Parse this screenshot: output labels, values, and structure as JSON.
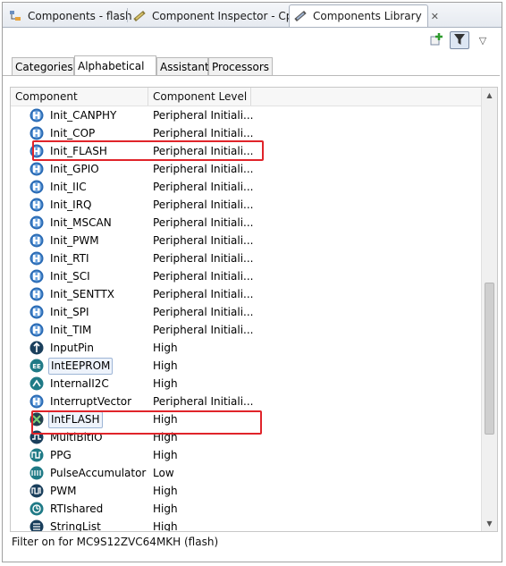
{
  "view_tabs": [
    {
      "label": "Components - flash",
      "icon": "components-tree-icon",
      "active": false
    },
    {
      "label": "Component Inspector - Cpu",
      "icon": "inspector-icon",
      "active": false
    },
    {
      "label": "Components Library",
      "icon": "library-icon",
      "active": true,
      "close": "✕"
    }
  ],
  "toolbar": {
    "add_tooltip": "add-component-icon",
    "filter_tooltip": "filter-icon",
    "menu_glyph": "▽"
  },
  "sub_tabs": [
    {
      "label": "Categories",
      "active": false
    },
    {
      "label": "Alphabetical",
      "active": true
    },
    {
      "label": "Assistant",
      "active": false
    },
    {
      "label": "Processors",
      "active": false
    }
  ],
  "table": {
    "columns": [
      "Component",
      "Component Level"
    ],
    "rows": [
      {
        "name": "Init_CANPHY",
        "level": "Peripheral Initiali...",
        "icon": "init-icon"
      },
      {
        "name": "Init_COP",
        "level": "Peripheral Initiali...",
        "icon": "init-icon"
      },
      {
        "name": "Init_FLASH",
        "level": "Peripheral Initiali...",
        "icon": "init-icon"
      },
      {
        "name": "Init_GPIO",
        "level": "Peripheral Initiali...",
        "icon": "init-icon"
      },
      {
        "name": "Init_IIC",
        "level": "Peripheral Initiali...",
        "icon": "init-icon"
      },
      {
        "name": "Init_IRQ",
        "level": "Peripheral Initiali...",
        "icon": "init-icon"
      },
      {
        "name": "Init_MSCAN",
        "level": "Peripheral Initiali...",
        "icon": "init-icon"
      },
      {
        "name": "Init_PWM",
        "level": "Peripheral Initiali...",
        "icon": "init-icon"
      },
      {
        "name": "Init_RTI",
        "level": "Peripheral Initiali...",
        "icon": "init-icon"
      },
      {
        "name": "Init_SCI",
        "level": "Peripheral Initiali...",
        "icon": "init-icon"
      },
      {
        "name": "Init_SENTTX",
        "level": "Peripheral Initiali...",
        "icon": "init-icon"
      },
      {
        "name": "Init_SPI",
        "level": "Peripheral Initiali...",
        "icon": "init-icon"
      },
      {
        "name": "Init_TIM",
        "level": "Peripheral Initiali...",
        "icon": "init-icon"
      },
      {
        "name": "InputPin",
        "level": "High",
        "icon": "input-pin-icon"
      },
      {
        "name": "IntEEPROM",
        "level": "High",
        "icon": "eeprom-icon"
      },
      {
        "name": "InternalI2C",
        "level": "High",
        "icon": "i2c-icon"
      },
      {
        "name": "InterruptVector",
        "level": "Peripheral Initiali...",
        "icon": "init-icon"
      },
      {
        "name": "IntFLASH",
        "level": "High",
        "icon": "flash-icon"
      },
      {
        "name": "MultiBitIO",
        "level": "High",
        "icon": "bitio-icon"
      },
      {
        "name": "PPG",
        "level": "High",
        "icon": "ppg-icon"
      },
      {
        "name": "PulseAccumulator",
        "level": "Low",
        "icon": "pulse-icon"
      },
      {
        "name": "PWM",
        "level": "High",
        "icon": "pwm-icon"
      },
      {
        "name": "RTIshared",
        "level": "High",
        "icon": "rti-icon"
      },
      {
        "name": "StringList",
        "level": "High",
        "icon": "stringlist-icon"
      }
    ]
  },
  "status": "Filter on for MC9S12ZVC64MKH (flash)",
  "colors": {
    "highlight": "#e0242a",
    "accent": "#2a6bb5"
  }
}
